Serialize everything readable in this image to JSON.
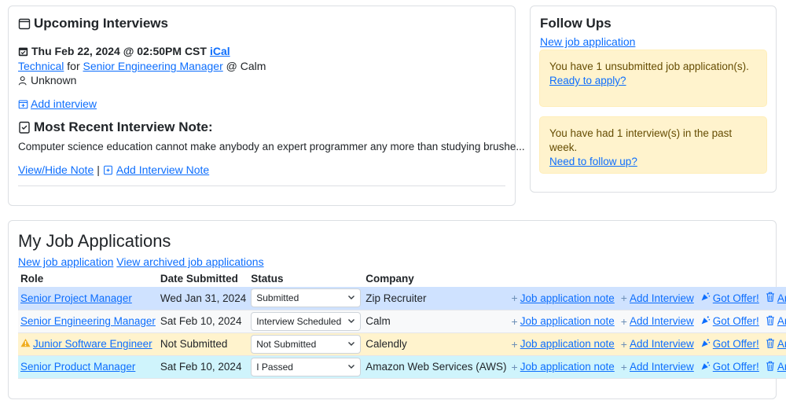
{
  "interviews": {
    "title": "Upcoming Interviews",
    "datetime": "Thu Feb 22, 2024 @ 02:50PM CST",
    "ical": "iCal",
    "type": "Technical",
    "for_text": "for",
    "role": "Senior Engineering Manager",
    "at_text": "@ Calm",
    "interviewer": "Unknown",
    "add_interview": "Add interview",
    "note_title": "Most Recent Interview Note:",
    "note_text": "Computer science education cannot make anybody an expert programmer any more than studying brushe...",
    "view_hide": "View/Hide Note",
    "separator": "|",
    "add_note": "Add Interview Note"
  },
  "followups": {
    "title": "Follow Ups",
    "new_app": "New job application",
    "alerts": [
      {
        "text": "You have 1 unsubmitted job application(s).",
        "link": "Ready to apply?"
      },
      {
        "text": "You have had 1 interview(s) in the past week.",
        "link": "Need to follow up?"
      }
    ]
  },
  "jobs": {
    "title": "My Job Applications",
    "new_app": "New job application",
    "view_archived": "View archived job applications",
    "columns": [
      "Role",
      "Date Submitted",
      "Status",
      "Company"
    ],
    "rows": [
      {
        "role": "Senior Project Manager",
        "date": "Wed Jan 31, 2024",
        "status": "Submitted",
        "company": "Zip Recruiter",
        "warn": false
      },
      {
        "role": "Senior Engineering Manager",
        "date": "Sat Feb 10, 2024",
        "status": "Interview Scheduled",
        "company": "Calm",
        "warn": false
      },
      {
        "role": "Junior Software Engineer",
        "date": "Not Submitted",
        "status": "Not Submitted",
        "company": "Calendly",
        "warn": true
      },
      {
        "role": "Senior Product Manager",
        "date": "Sat Feb 10, 2024",
        "status": "I Passed",
        "company": "Amazon Web Services (AWS)",
        "warn": false
      }
    ],
    "actions": {
      "note": "Job application note",
      "interview": "Add Interview",
      "offer": "Got Offer!",
      "archive": "Archive"
    }
  },
  "colors": {
    "link": "#0d6efd",
    "alert_bg": "#fff3cd",
    "row_blue": "#cfe2ff",
    "row_yellow": "#fff3cd",
    "row_cyan": "#cff4fc"
  }
}
